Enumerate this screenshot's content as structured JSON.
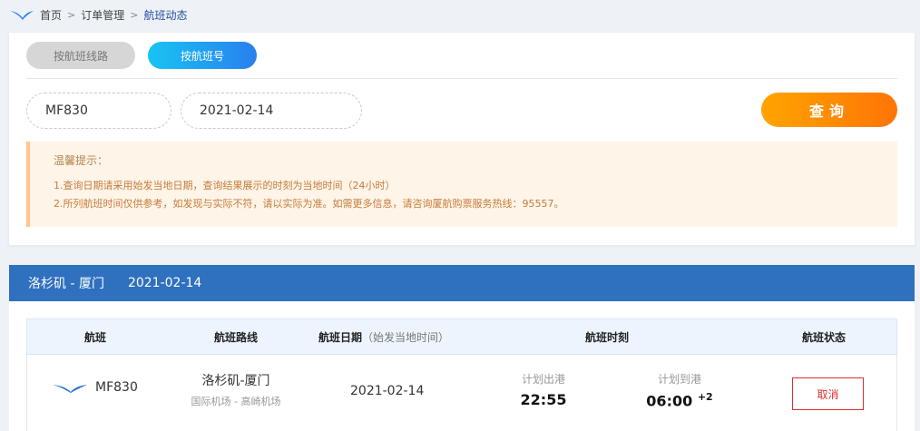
{
  "breadcrumb": {
    "home": "首页",
    "orders": "订单管理",
    "current": "航班动态"
  },
  "search": {
    "tabs": {
      "by_route": "按航班线路",
      "by_number": "按航班号"
    },
    "flight_no_value": "MF830",
    "date_value": "2021-02-14",
    "query_label": "查询"
  },
  "notice": {
    "title": "温馨提示：",
    "line1": "1.查询日期请采用始发当地日期，查询结果展示的时刻为当地时间（24小时）",
    "line2": "2.所列航班时间仅供参考，如发现与实际不符，请以实际为准。如需更多信息，请咨询厦航购票服务热线：95557。"
  },
  "result_header": {
    "route": "洛杉矶 - 厦门",
    "date": "2021-02-14"
  },
  "table": {
    "headers": {
      "flight": "航班",
      "route": "航班路线",
      "date": "航班日期",
      "date_note": "（始发当地时间）",
      "times": "航班时刻",
      "status": "航班状态"
    },
    "row": {
      "flight_no": "MF830",
      "route": "洛杉矶-厦门",
      "airports": "国际机场 - 高崎机场",
      "date": "2021-02-14",
      "dep_label": "计划出港",
      "dep_time": "22:55",
      "arr_label": "计划到港",
      "arr_time": "06:00",
      "arr_offset": "+2",
      "status": "取消"
    }
  },
  "colors": {
    "brand_blue": "#2f70bf",
    "query_orange": "#ff8a00",
    "tab_active": "#1aa6f0",
    "cancel_red": "#d92f2f",
    "notice_bg": "#fff4e8"
  },
  "icons": {
    "logo": "xiamen-airlines-egret-icon",
    "row_logo": "xiamen-airlines-egret-icon"
  }
}
